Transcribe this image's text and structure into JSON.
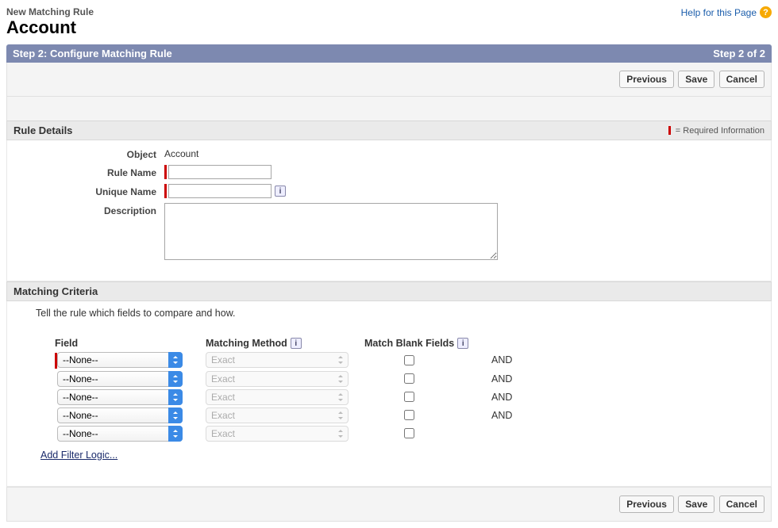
{
  "header": {
    "breadcrumb": "New Matching Rule",
    "title": "Account",
    "help_label": "Help for this Page"
  },
  "step_bar": {
    "title": "Step 2: Configure Matching Rule",
    "progress": "Step 2 of 2"
  },
  "buttons": {
    "previous": "Previous",
    "save": "Save",
    "cancel": "Cancel"
  },
  "rule_details": {
    "section_title": "Rule Details",
    "required_legend": "= Required Information",
    "object_label": "Object",
    "object_value": "Account",
    "rule_name_label": "Rule Name",
    "rule_name_value": "",
    "unique_name_label": "Unique Name",
    "unique_name_value": "",
    "description_label": "Description",
    "description_value": ""
  },
  "criteria": {
    "section_title": "Matching Criteria",
    "instruction": "Tell the rule which fields to compare and how.",
    "col_field": "Field",
    "col_method": "Matching Method",
    "col_blank": "Match Blank Fields",
    "none_option": "--None--",
    "exact_option": "Exact",
    "and_label": "AND",
    "filter_link": "Add Filter Logic..."
  }
}
